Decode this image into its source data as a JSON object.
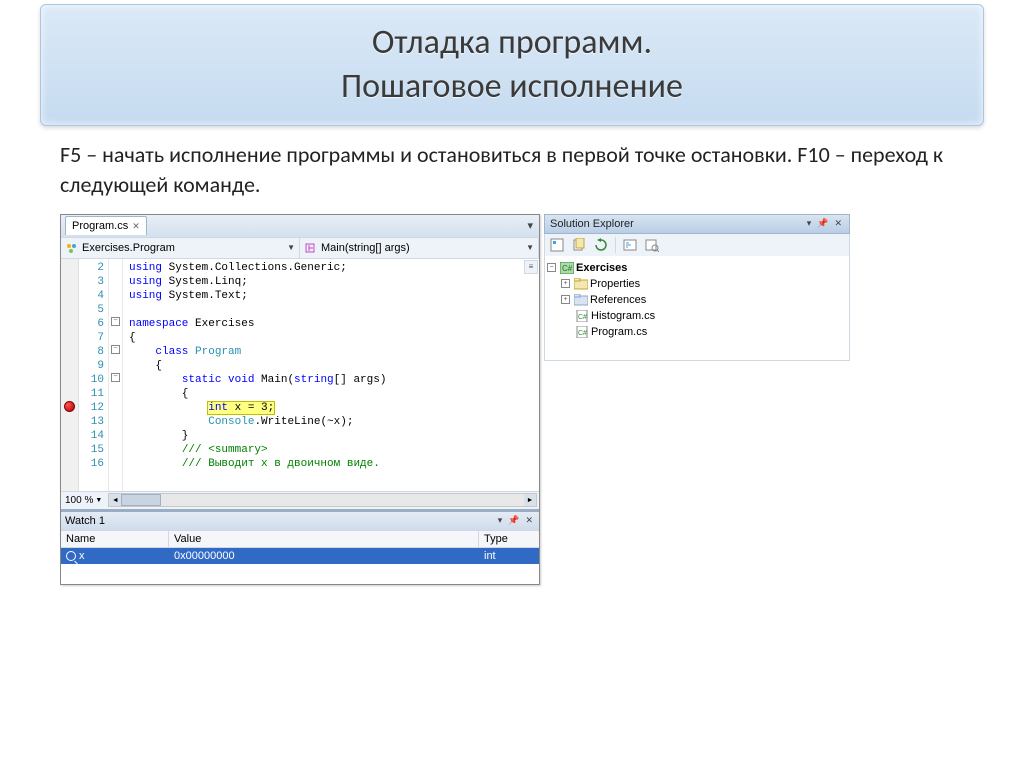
{
  "title_line1": "Отладка программ.",
  "title_line2": "Пошаговое исполнение",
  "description": "F5 – начать исполнение программы и остановиться в первой точке остановки. F10 – переход к следующей команде.",
  "tab": {
    "label": "Program.cs"
  },
  "nav": {
    "scope": "Exercises.Program",
    "member": "Main(string[] args)"
  },
  "code": {
    "lines": [
      {
        "n": 2,
        "html": "<span class='kw'>using</span> System.Collections.Generic;"
      },
      {
        "n": 3,
        "html": "<span class='kw'>using</span> System.Linq;"
      },
      {
        "n": 4,
        "html": "<span class='kw'>using</span> System.Text;"
      },
      {
        "n": 5,
        "html": ""
      },
      {
        "n": 6,
        "html": "<span class='kw'>namespace</span> Exercises"
      },
      {
        "n": 7,
        "html": "{"
      },
      {
        "n": 8,
        "html": "    <span class='kw'>class</span> <span class='tp'>Program</span>"
      },
      {
        "n": 9,
        "html": "    {"
      },
      {
        "n": 10,
        "html": "        <span class='kw'>static</span> <span class='kw'>void</span> Main(<span class='kw'>string</span>[] args)"
      },
      {
        "n": 11,
        "html": "        {"
      },
      {
        "n": 12,
        "html": "            <span class='cur-line'><span class='kw'>int</span> x = 3;</span>"
      },
      {
        "n": 13,
        "html": "            <span class='tp'>Console</span>.WriteLine(~x);"
      },
      {
        "n": 14,
        "html": "        }"
      },
      {
        "n": 15,
        "html": "        <span class='cmt'>/// &lt;summary&gt;</span>"
      },
      {
        "n": 16,
        "html": "        <span class='cmt'>/// Выводит x в двоичном виде.</span>"
      }
    ]
  },
  "zoom": "100 %",
  "watch": {
    "title": "Watch 1",
    "cols": {
      "name": "Name",
      "value": "Value",
      "type": "Type"
    },
    "row": {
      "name": "x",
      "value": "0x00000000",
      "type": "int"
    }
  },
  "solution": {
    "title": "Solution Explorer",
    "project": "Exercises",
    "items": [
      "Properties",
      "References",
      "Histogram.cs",
      "Program.cs"
    ]
  }
}
